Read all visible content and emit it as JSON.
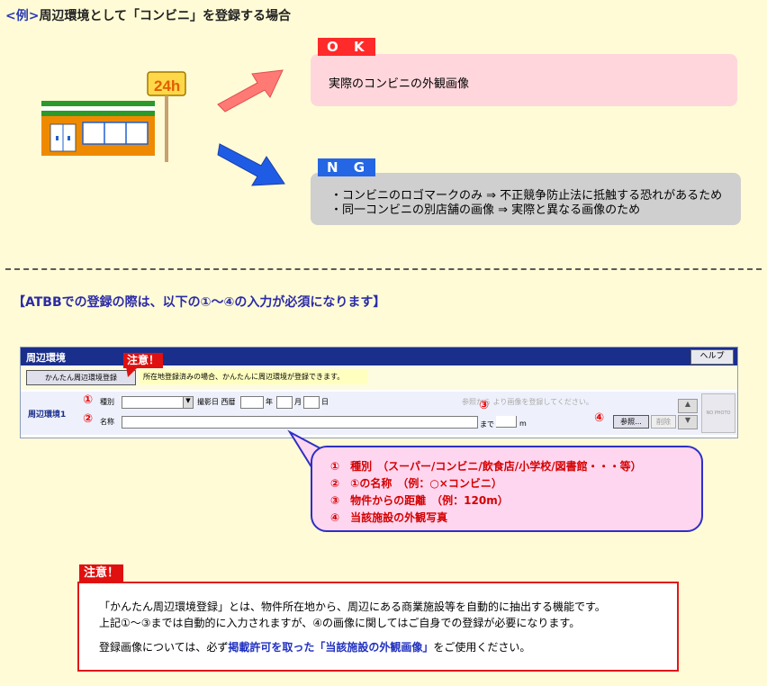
{
  "title": {
    "prefix": "<例>",
    "text": "周辺環境として「コンビニ」を登録する場合"
  },
  "store_sign": "24h",
  "ok": {
    "badge": "O K",
    "text": "実際のコンビニの外観画像"
  },
  "ng": {
    "badge": "N G",
    "line1": "・コンビニのロゴマークのみ ⇒ 不正競争防止法に抵触する恐れがあるため",
    "line2": "・同一コンビニの別店舗の画像 ⇒ 実際と異なる画像のため"
  },
  "requirement": "【ATBBでの登録の際は、以下の①～④の入力が必須になります】",
  "form": {
    "header_title": "周辺環境",
    "help_button": "ヘルプ",
    "easy_button": "かんたん周辺環境登録",
    "easy_note": "所在地登録済みの場合、かんたんに周辺環境が登録できます。",
    "row_label": "周辺環境1",
    "type_label": "種別",
    "date_label": "撮影日 西暦",
    "year": "年",
    "month": "月",
    "day": "日",
    "name_label": "名称",
    "hint": "参照から より画像を登録してください。",
    "until": "まで",
    "meter": "m",
    "ref_button": "参照...",
    "delete_button": "削除",
    "up_arrow": "▲",
    "down_arrow": "▼",
    "no_photo": "NO PHOTO"
  },
  "markers": {
    "m1": "①",
    "m2": "②",
    "m3": "③",
    "m4": "④"
  },
  "caution_label": "注意！",
  "callout": {
    "line1": "①　種別　（スーパー/コンビニ/飲食店/小学校/図書館・・・等）",
    "line2": "②　①の名称　（例：○×コンビニ）",
    "line3": "③　物件からの距離　（例：120m）",
    "line4": "④　当該施設の外観写真"
  },
  "note": {
    "label": "注意！",
    "line1": "「かんたん周辺環境登録」とは、物件所在地から、周辺にある商業施設等を自動的に抽出する機能です。",
    "line2": "上記①～③までは自動的に入力されますが、④の画像に関してはご自身での登録が必要になります。",
    "line3_pre": "登録画像については、必ず",
    "line3_em": "掲載許可を取った「当該施設の外観画像」",
    "line3_post": "をご使用ください。"
  }
}
